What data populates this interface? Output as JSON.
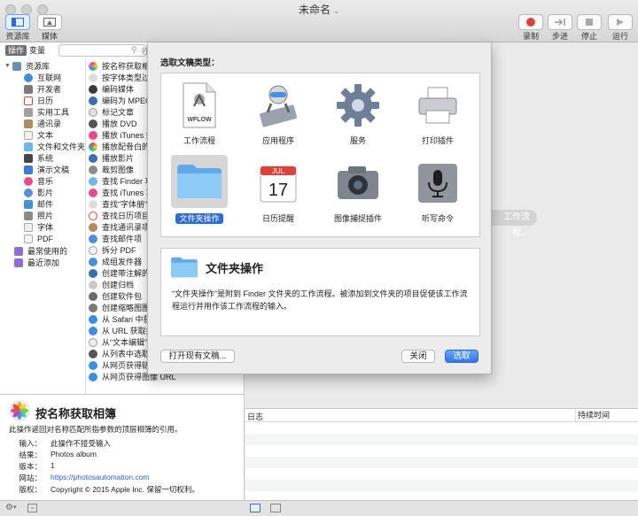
{
  "window": {
    "title": "未命名"
  },
  "toolbar": {
    "left": [
      {
        "label": "资源库"
      },
      {
        "label": "媒体"
      }
    ],
    "right": [
      {
        "label": "录制"
      },
      {
        "label": "步进"
      },
      {
        "label": "停止"
      },
      {
        "label": "运行"
      }
    ]
  },
  "library": {
    "tabs": [
      "操作",
      "变量"
    ],
    "search_placeholder": "名",
    "root": "资源库",
    "categories": [
      "互联网",
      "开发者",
      "日历",
      "实用工具",
      "通讯录",
      "文本",
      "文件和文件夹",
      "系统",
      "演示文稿",
      "音乐",
      "影片",
      "邮件",
      "照片",
      "字体",
      "PDF"
    ],
    "extras": [
      "最常使用的",
      "最近添加"
    ]
  },
  "actions": [
    "按名称获取相簿",
    "按字体类型过滤",
    "编码媒体",
    "编码为 MPEG",
    "标记文章",
    "播放 DVD",
    "播放 iTunes 播",
    "播放配骨白的幻",
    "播放影片",
    "裁剪图像",
    "查找 Finder 项",
    "查找 iTunes 项",
    "查找“字体册”",
    "查找日历项目",
    "查找通讯录项目",
    "查找邮件项",
    "拆分 PDF",
    "成组发件器",
    "创建带注解的图",
    "创建归档",
    "创建软件包",
    "创建缩略图图像",
    "从 Safari 中获",
    "从 URL 获取提",
    "从“文本编辑”",
    "从列表中选取",
    "从网页获得链接 URL",
    "从网页获得图像 URL"
  ],
  "description": {
    "title": "按名称获取相簿",
    "text": "此操作返回对名称匹配所指参数的顶层相簿的引用。",
    "meta": [
      {
        "key": "输入：",
        "value": "此操作不接受输入"
      },
      {
        "key": "结果：",
        "value": "Photos album"
      },
      {
        "key": "版本：",
        "value": "1"
      },
      {
        "key": "网站：",
        "value": "https://photosautomation.com"
      },
      {
        "key": "版权：",
        "value": "Copyright © 2015 Apple Inc. 保留一切权利。"
      }
    ]
  },
  "workflow": {
    "hint_fragment": "工作流程。"
  },
  "log": {
    "col_log": "日志",
    "col_duration": "持续时间"
  },
  "sheet": {
    "title": "选取文稿类型：",
    "types": [
      {
        "label": "工作流程",
        "badge": "WFLOW"
      },
      {
        "label": "应用程序"
      },
      {
        "label": "服务"
      },
      {
        "label": "打印插件"
      },
      {
        "label": "文件夹操作",
        "selected": true
      },
      {
        "label": "日历提醒",
        "month": "JUL",
        "day": "17"
      },
      {
        "label": "图像捕捉插件"
      },
      {
        "label": "听写命令"
      }
    ],
    "detail_title": "文件夹操作",
    "detail_text": "“文件夹操作”是附到 Finder 文件夹的工作流程。被添加到文件夹的项目促使该工作流程运行并用作该工作流程的输入。",
    "open_existing": "打开现有文稿...",
    "close": "关闭",
    "choose": "选取"
  },
  "colors": {
    "accent": "#2d6bd6",
    "folder": "#6cb7f0",
    "record": "#d6433d"
  }
}
